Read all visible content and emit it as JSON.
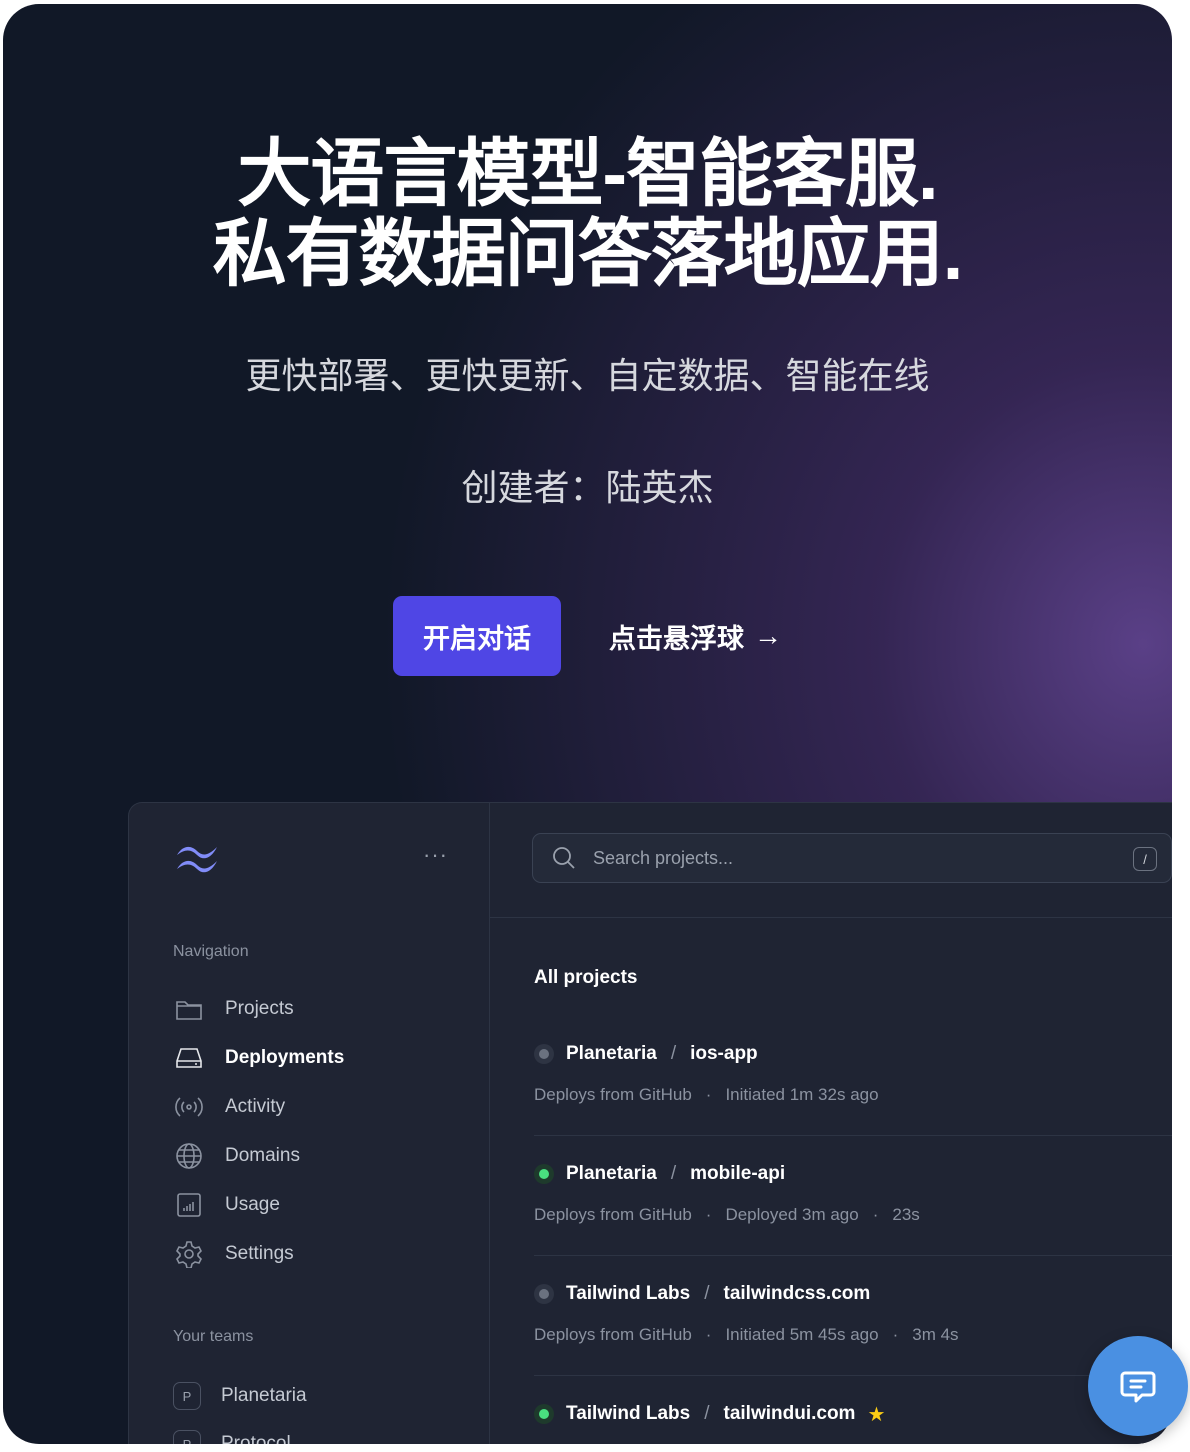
{
  "hero": {
    "title_line1": "大语言模型-智能客服.",
    "title_line2": "私有数据问答落地应用.",
    "subtitle": "更快部署、更快更新、自定数据、智能在线",
    "creator": "创建者：陆英杰",
    "start_button": "开启对话",
    "float_link": "点击悬浮球",
    "float_link_arrow": "→"
  },
  "sidebar": {
    "more_label": "···",
    "nav_heading": "Navigation",
    "items": [
      {
        "label": "Projects",
        "icon": "folder-icon",
        "active": false
      },
      {
        "label": "Deployments",
        "icon": "server-icon",
        "active": true
      },
      {
        "label": "Activity",
        "icon": "signal-icon",
        "active": false
      },
      {
        "label": "Domains",
        "icon": "globe-icon",
        "active": false
      },
      {
        "label": "Usage",
        "icon": "chart-icon",
        "active": false
      },
      {
        "label": "Settings",
        "icon": "gear-icon",
        "active": false
      }
    ],
    "teams_heading": "Your teams",
    "teams": [
      {
        "initial": "P",
        "name": "Planetaria"
      },
      {
        "initial": "P",
        "name": "Protocol"
      }
    ]
  },
  "search": {
    "placeholder": "Search projects...",
    "shortcut": "/"
  },
  "projects": {
    "heading": "All projects",
    "items": [
      {
        "team": "Planetaria",
        "name": "ios-app",
        "status": "grey",
        "source": "Deploys from GitHub",
        "state": "Initiated 1m 32s ago",
        "duration": ""
      },
      {
        "team": "Planetaria",
        "name": "mobile-api",
        "status": "green",
        "source": "Deploys from GitHub",
        "state": "Deployed 3m ago",
        "duration": "23s"
      },
      {
        "team": "Tailwind Labs",
        "name": "tailwindcss.com",
        "status": "grey",
        "source": "Deploys from GitHub",
        "state": "Initiated 5m 45s ago",
        "duration": "3m 4s"
      },
      {
        "team": "Tailwind Labs",
        "name": "tailwindui.com",
        "status": "green",
        "source": "",
        "state": "",
        "duration": "",
        "starred": true
      }
    ],
    "separator": "/",
    "bullet": "·"
  },
  "colors": {
    "accent": "#4f46e5",
    "fab": "#4a90e2",
    "status_green": "#4ade80",
    "status_grey": "#6b7280",
    "star": "#facc15"
  }
}
